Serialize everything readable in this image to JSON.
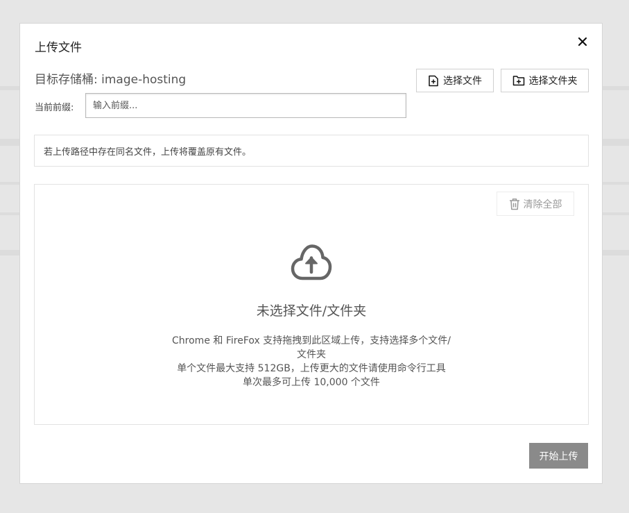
{
  "modal": {
    "title": "上传文件",
    "bucket_text": "目标存储桶: image-hosting"
  },
  "toolbar": {
    "select_file_label": "选择文件",
    "select_folder_label": "选择文件夹"
  },
  "prefix": {
    "label": "当前前缀:",
    "placeholder": "输入前缀..."
  },
  "notice": {
    "text": "若上传路径中存在同名文件，上传将覆盖原有文件。"
  },
  "dropzone": {
    "clear_label": "清除全部",
    "empty_title": "未选择文件/文件夹",
    "desc_line1": "Chrome 和 FireFox 支持拖拽到此区域上传，支持选择多个文件/文件夹",
    "desc_line2": "单个文件最大支持 512GB，上传更大的文件请使用命令行工具",
    "desc_line3": "单次最多可上传 10,000 个文件"
  },
  "footer": {
    "start_label": "开始上传"
  },
  "icons": [
    "close-icon",
    "file-plus-icon",
    "folder-plus-icon",
    "trash-icon",
    "cloud-upload-icon"
  ],
  "colors": {
    "primary_button_disabled": "#8a8a8a",
    "backdrop": "#e6e6e6"
  }
}
